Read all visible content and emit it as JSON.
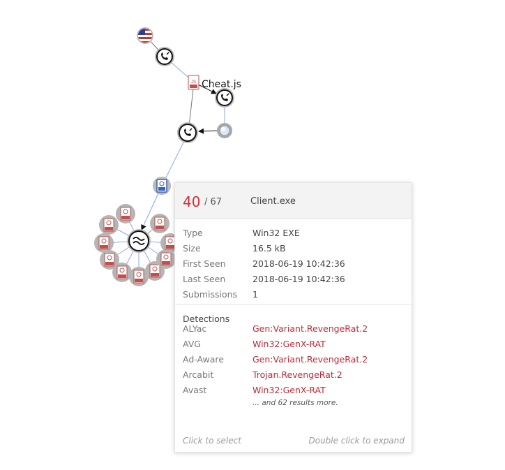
{
  "graph": {
    "label_cheat": "Cheat.js",
    "exe_badge": "EXE",
    "js_badge": "JS"
  },
  "tooltip": {
    "score": "40",
    "total": "/ 67",
    "filename": "Client.exe",
    "properties": [
      {
        "key": "Type",
        "value": "Win32 EXE"
      },
      {
        "key": "Size",
        "value": "16.5 kB"
      },
      {
        "key": "First Seen",
        "value": "2018-06-19 10:42:36"
      },
      {
        "key": "Last Seen",
        "value": "2018-06-19 10:42:36"
      },
      {
        "key": "Submissions",
        "value": "1"
      }
    ],
    "detections_title": "Detections",
    "detections": [
      {
        "engine": "ALYac",
        "result": "Gen:Variant.RevengeRat.2"
      },
      {
        "engine": "AVG",
        "result": "Win32:GenX-RAT"
      },
      {
        "engine": "Ad-Aware",
        "result": "Gen:Variant.RevengeRat.2"
      },
      {
        "engine": "Arcabit",
        "result": "Trojan.RevengeRat.2"
      },
      {
        "engine": "Avast",
        "result": "Win32:GenX-RAT"
      }
    ],
    "more_results": "... and 62 results more.",
    "footer_left": "Click to select",
    "footer_right": "Double click to expand"
  },
  "colors": {
    "edge_blue": "#8ea6de",
    "edge_gray": "#777777",
    "node_gray": "#a8a8a8",
    "exe_red": "#c0504d",
    "score_red": "#d32f3a",
    "detection_red": "#c62833",
    "file_blue": "#3a63b8"
  },
  "icons": {
    "flag": "us-flag-icon",
    "call": "phone-call-icon",
    "file": "file-icon",
    "globe": "globe-icon",
    "family": "wave-similarity-icon",
    "exe": "exe-file-icon"
  }
}
